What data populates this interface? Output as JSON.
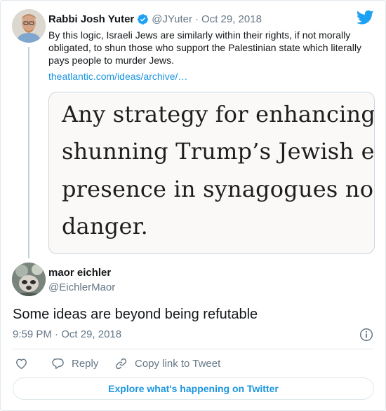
{
  "colors": {
    "link": "#1b95e0",
    "text": "#14171a",
    "muted": "#657786",
    "verified": "#1da1f2",
    "divider": "#e1e8ed"
  },
  "quoted_tweet": {
    "display_name": "Rabbi Josh Yuter",
    "verified_icon": "verified-badge-icon",
    "handle": "@JYuter",
    "separator": "·",
    "date": "Oct 29, 2018",
    "text": "By this logic, Israeli Jews are similarly within their rights, if not morally obligated, to shun those who support the Palestinian state which literally pays people to murder Jews.",
    "link": "theatlantic.com/ideas/archive/…",
    "media": {
      "lines": [
        "Any strategy for enhancing th",
        "shunning Trump’s Jewish ena",
        "presence in synagogues not w",
        "danger."
      ]
    }
  },
  "brand_icon": "twitter-bird-icon",
  "tweet": {
    "display_name": "maor eichler",
    "handle": "@EichlerMaor",
    "text": "Some ideas are beyond being refutable",
    "time": "9:59 PM",
    "separator": "·",
    "date": "Oct 29, 2018",
    "info_icon": "info-icon"
  },
  "actions": {
    "like_icon": "heart-icon",
    "reply_label": "Reply",
    "copy_label": "Copy link to Tweet"
  },
  "explore_label": "Explore what's happening on Twitter"
}
